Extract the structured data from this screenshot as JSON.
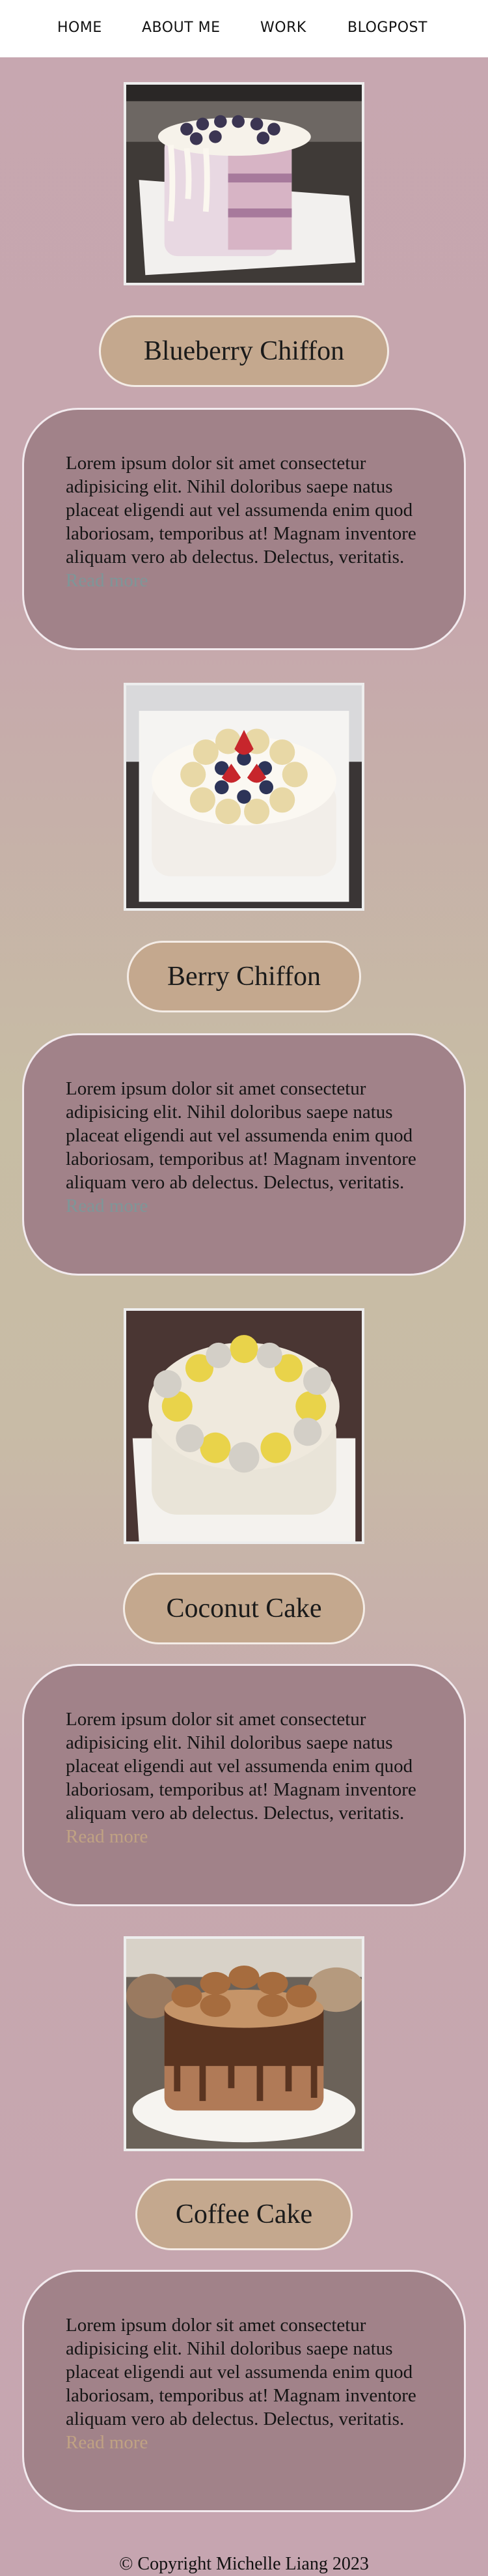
{
  "nav": {
    "items": [
      {
        "label": "HOME"
      },
      {
        "label": "ABOUT ME"
      },
      {
        "label": "WORK"
      },
      {
        "label": "BLOGPOST"
      }
    ]
  },
  "cakes": [
    {
      "title": "Blueberry Chiffon",
      "description": "Lorem ipsum dolor sit amet consectetur adipisicing elit. Nihil doloribus saepe natus placeat eligendi aut vel assumenda enim quod laboriosam, temporibus at! Magnam inventore aliquam vero ab delectus. Delectus, veritatis.",
      "read_more": "Read more",
      "read_more_color": "#7e9698"
    },
    {
      "title": "Berry Chiffon",
      "description": "Lorem ipsum dolor sit amet consectetur adipisicing elit. Nihil doloribus saepe natus placeat eligendi aut vel assumenda enim quod laboriosam, temporibus at! Magnam inventore aliquam vero ab delectus. Delectus, veritatis.",
      "read_more": "Read more",
      "read_more_color": "#7e9698"
    },
    {
      "title": "Coconut Cake",
      "description": "Lorem ipsum dolor sit amet consectetur adipisicing elit. Nihil doloribus saepe natus placeat eligendi aut vel assumenda enim quod laboriosam, temporibus at! Magnam inventore aliquam vero ab delectus. Delectus, veritatis.",
      "read_more": "Read more",
      "read_more_color": "#c0a283"
    },
    {
      "title": "Coffee Cake",
      "description": "Lorem ipsum dolor sit amet consectetur adipisicing elit. Nihil doloribus saepe natus placeat eligendi aut vel assumenda enim quod laboriosam, temporibus at! Magnam inventore aliquam vero ab delectus. Delectus, veritatis.",
      "read_more": "Read more",
      "read_more_color": "#c0a283"
    }
  ],
  "footer": {
    "copyright": "© Copyright Michelle Liang 2023"
  },
  "colors": {
    "page_background": "#c7a7b0",
    "title_pill": "#c4a88e",
    "description_card": "#a18289"
  }
}
